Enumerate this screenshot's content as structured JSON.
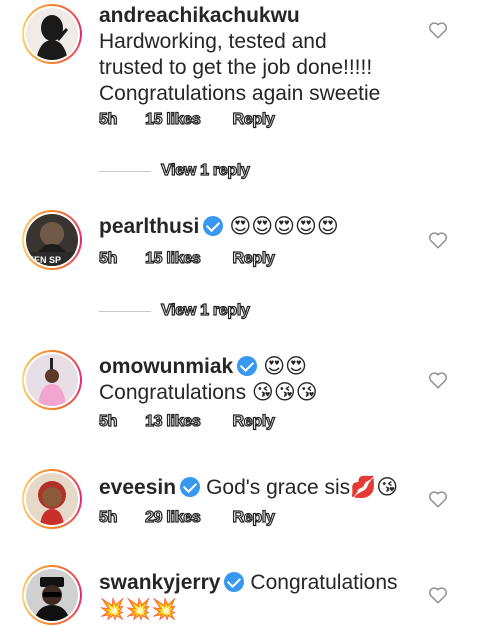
{
  "comments": [
    {
      "username": "andreachikachukwu",
      "verified": false,
      "text_lines": [
        "Hardworking, tested and",
        "trusted to get the job done!!!!!",
        "Congratulations again sweetie"
      ],
      "time": "5h",
      "likes": "15 likes",
      "reply": "Reply",
      "view_replies": "View 1 reply",
      "avatar_colors": [
        "#1a1a1a",
        "#ede8e2"
      ]
    },
    {
      "username": "pearlthusi",
      "verified": true,
      "text_inline": "😍😍😍😍😍",
      "time": "5h",
      "likes": "15 likes",
      "reply": "Reply",
      "view_replies": "View 1 reply",
      "avatar_caption": "EEN SP",
      "avatar_colors": [
        "#2b2b2b",
        "#7a6c5d"
      ]
    },
    {
      "username": "omowunmiak",
      "verified": true,
      "text_inline": "😍😍",
      "text_line2": "Congratulations 😘😘😘",
      "time": "5h",
      "likes": "13 likes",
      "reply": "Reply",
      "avatar_colors": [
        "#f2b8d6",
        "#d5a3c0"
      ]
    },
    {
      "username": "eveesin",
      "verified": true,
      "text_inline": "God's grace sis💋😘",
      "time": "5h",
      "likes": "29 likes",
      "reply": "Reply",
      "avatar_colors": [
        "#c9302c",
        "#e9c49a"
      ]
    },
    {
      "username": "swankyjerry",
      "verified": true,
      "text_inline": "Congratulations",
      "text_line2": "💥💥💥",
      "avatar_colors": [
        "#111111",
        "#c8c8c8"
      ]
    }
  ]
}
